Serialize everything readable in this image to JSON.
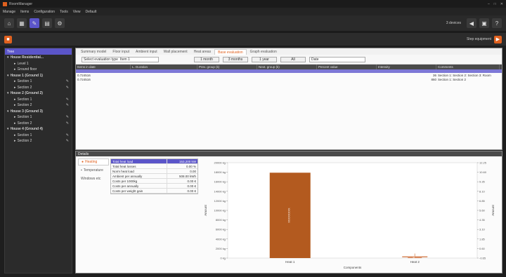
{
  "window": {
    "title": "RoomManager"
  },
  "menu": [
    "Manage",
    "Items",
    "Configuration",
    "Tools",
    "View",
    "Default"
  ],
  "toolbar": {
    "status_label": "3 devices"
  },
  "toolbar2": {
    "right_label": "Step equipment"
  },
  "sidebar": {
    "header": "Tree",
    "items": [
      {
        "label": "House Residential...",
        "level": 0,
        "type": "house"
      },
      {
        "label": "Level 1",
        "level": 1,
        "type": "leaf"
      },
      {
        "label": "Ground floor",
        "level": 1,
        "type": "leaf"
      },
      {
        "label": "House 1 (Ground 1)",
        "level": 0,
        "type": "house"
      },
      {
        "label": "Section 1",
        "level": 1,
        "type": "leaf"
      },
      {
        "label": "Section 2",
        "level": 1,
        "type": "leaf"
      },
      {
        "label": "House 2 (Ground 2)",
        "level": 0,
        "type": "house"
      },
      {
        "label": "Section 1",
        "level": 1,
        "type": "leaf"
      },
      {
        "label": "Section 2",
        "level": 1,
        "type": "leaf"
      },
      {
        "label": "House 3 (Ground 3)",
        "level": 0,
        "type": "house"
      },
      {
        "label": "Section 1",
        "level": 1,
        "type": "leaf"
      },
      {
        "label": "Section 2",
        "level": 1,
        "type": "leaf"
      },
      {
        "label": "House 4 (Ground 4)",
        "level": 0,
        "type": "house"
      },
      {
        "label": "Section 1",
        "level": 1,
        "type": "leaf"
      },
      {
        "label": "Section 2",
        "level": 1,
        "type": "leaf"
      }
    ]
  },
  "main": {
    "tabs": [
      "Summary model",
      "Floor input",
      "Ambient input",
      "Wall placement",
      "Heat areas",
      "Base evaluation",
      "Graph evaluation"
    ],
    "active_tab": 5,
    "filter": {
      "select_label": "Select evaluation type",
      "select_value": "Item 1",
      "buttons": [
        "1 month",
        "3 months",
        "1 year",
        "All"
      ],
      "date_value": "Date"
    },
    "columns": [
      "Items in date",
      "L. Duration",
      "Prev. group (k)",
      "Next. group (k)",
      "Percent value",
      "Intensity",
      "Comments"
    ],
    "rows": [
      {
        "cells": [
          "0.724516",
          "",
          "",
          "",
          "",
          "36",
          "Section 1: Section 2: Section 3: Room"
        ]
      },
      {
        "cells": [
          "0.724516",
          "",
          "",
          "",
          "",
          "860",
          "Section 1: Section 2"
        ]
      }
    ]
  },
  "bottom": {
    "header": "Details",
    "side_tabs": [
      "Heating",
      "Temperature",
      "Windows etc"
    ],
    "props": [
      {
        "k": "Total heat load",
        "v": "153,200 kW"
      },
      {
        "k": "Total heat losses",
        "v": "0.00 %"
      },
      {
        "k": "Norm heat load",
        "v": "0.00"
      },
      {
        "k": "Ambient per annually",
        "v": "508.00 kWh"
      },
      {
        "k": "Costs per 1000kg",
        "v": "0.00 €"
      },
      {
        "k": "Costs per annually",
        "v": "0.00 €"
      },
      {
        "k": "Costs per weight gain",
        "v": "0.00 €"
      }
    ]
  },
  "chart_data": {
    "type": "bar",
    "categories": [
      "Heat 1",
      "Heat 2"
    ],
    "values": [
      17900,
      250
    ],
    "bar_labels": [
      "XXXXXXXX",
      "X"
    ],
    "error": [
      0,
      700
    ],
    "ylim": [
      0,
      20000
    ],
    "yticks": [
      0,
      2000,
      4000,
      6000,
      8000,
      10000,
      12000,
      14000,
      16000,
      18000,
      20000
    ],
    "ytick_labels": [
      "0 kg",
      "2000 kg",
      "4000 kg",
      "6000 kg",
      "8000 kg",
      "10000 kg",
      "12000 kg",
      "14000 kg",
      "16000 kg",
      "18000 kg",
      "20000 kg"
    ],
    "xlabel": "Components",
    "ylabel": "Amount",
    "right_ylabel": "Amount",
    "right_ticks": [
      "12.25",
      "10.60",
      "9.35",
      "8.10",
      "6.85",
      "5.60",
      "4.35",
      "3.10",
      "1.85",
      "0.60",
      "-0.65"
    ],
    "colors": {
      "bar": "#b35a1f",
      "bar2": "#d88a5e"
    },
    "grid": false,
    "legend": "none"
  }
}
